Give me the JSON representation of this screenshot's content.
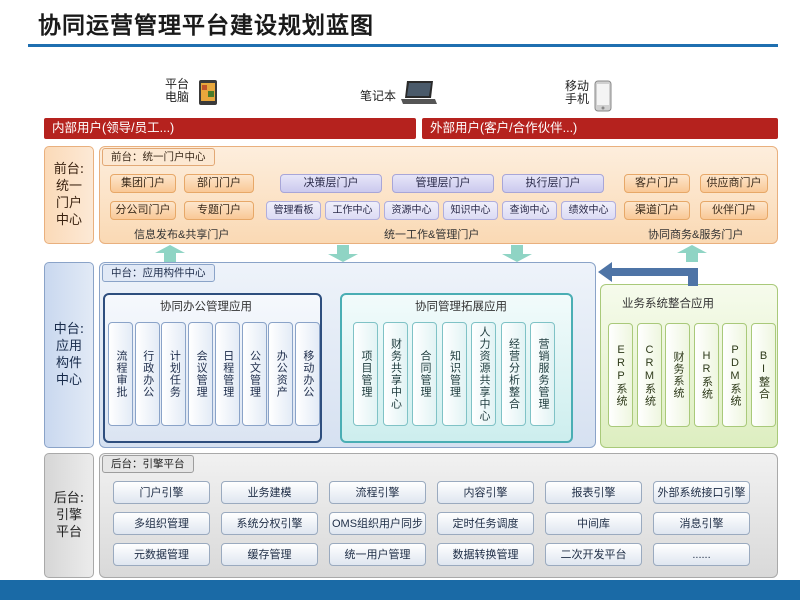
{
  "title": "协同运营管理平台建设规划蓝图",
  "devices": {
    "tablet": {
      "line1": "平台",
      "line2": "电脑"
    },
    "laptop": {
      "label": "笔记本"
    },
    "phone": {
      "line1": "移动",
      "line2": "手机"
    }
  },
  "users": {
    "internal": "内部用户(领导/员工...)",
    "external": "外部用户(客户/合作伙伴...)"
  },
  "front": {
    "row_label": "前台:\n统一\n门户\n中心",
    "tab": "前台：统一门户中心",
    "left_group": {
      "items": [
        "集团门户",
        "部门门户",
        "分公司门户",
        "专题门户"
      ],
      "caption": "信息发布&共享门户"
    },
    "mid_group": {
      "top": [
        "决策层门户",
        "管理层门户",
        "执行层门户"
      ],
      "bottom": [
        "管理看板",
        "工作中心",
        "资源中心",
        "知识中心",
        "查询中心",
        "绩效中心"
      ],
      "caption": "统一工作&管理门户"
    },
    "right_group": {
      "items": [
        "客户门户",
        "供应商门户",
        "渠道门户",
        "伙伴门户"
      ],
      "caption": "协同商务&服务门户"
    }
  },
  "middle": {
    "row_label": "中台:\n应用\n构件\n中心",
    "tab": "中台：应用构件中心",
    "office": {
      "title": "协同办公管理应用",
      "items": [
        "流程审批",
        "行政办公",
        "计划任务",
        "会议管理",
        "日程管理",
        "公文管理",
        "办公资产",
        "移动办公"
      ]
    },
    "mgmt": {
      "title": "协同管理拓展应用",
      "items": [
        "项目管理",
        "财务共享中心",
        "合同管理",
        "知识管理",
        "人力资源共享中心",
        "经营分析整合",
        "营销服务管理"
      ]
    },
    "biz": {
      "title": "业务系统整合应用",
      "items": [
        "ERP系统",
        "CRM系统",
        "财务系统",
        "HR系统",
        "PDM系统",
        "BI整合"
      ]
    }
  },
  "back": {
    "row_label": "后台:\n引擎\n平台",
    "tab": "后台：引擎平台",
    "rows": [
      [
        "门户引擎",
        "业务建模",
        "流程引擎",
        "内容引擎",
        "报表引擎",
        "外部系统接口引擎"
      ],
      [
        "多组织管理",
        "系统分权引擎",
        "OMS组织用户同步",
        "定时任务调度",
        "中间库",
        "消息引擎"
      ],
      [
        "元数据管理",
        "缓存管理",
        "统一用户管理",
        "数据转换管理",
        "二次开发平台",
        "......"
      ]
    ]
  },
  "colors": {
    "accent": "#1f6fb0",
    "red_bar": "#b5221e",
    "front_bg": "#fce4cc",
    "middle_bg": "#e4ecf7",
    "back_bg": "#e2e2e2"
  }
}
